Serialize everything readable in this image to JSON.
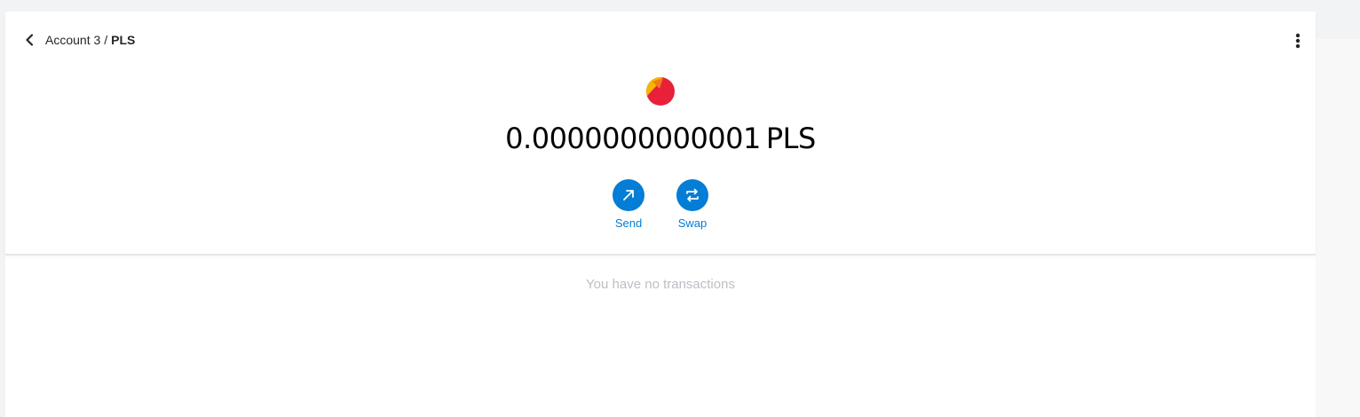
{
  "breadcrumb": {
    "account": "Account 3",
    "separator": "/",
    "token": "PLS"
  },
  "icons": {
    "back": "chevron-left-icon",
    "menu": "vertical-dots-icon",
    "send": "arrow-up-right-icon",
    "swap": "swap-arrows-icon",
    "token_logo": "pulsechain-logo"
  },
  "balance": {
    "amount": "0.0000000000001",
    "unit": "PLS"
  },
  "actions": {
    "send_label": "Send",
    "swap_label": "Swap"
  },
  "transactions": {
    "empty_message": "You have no transactions"
  },
  "colors": {
    "primary": "#037dd6",
    "muted_text": "#bbc0c5",
    "logo_red": "#e8203a",
    "logo_yellow": "#f5b600"
  }
}
